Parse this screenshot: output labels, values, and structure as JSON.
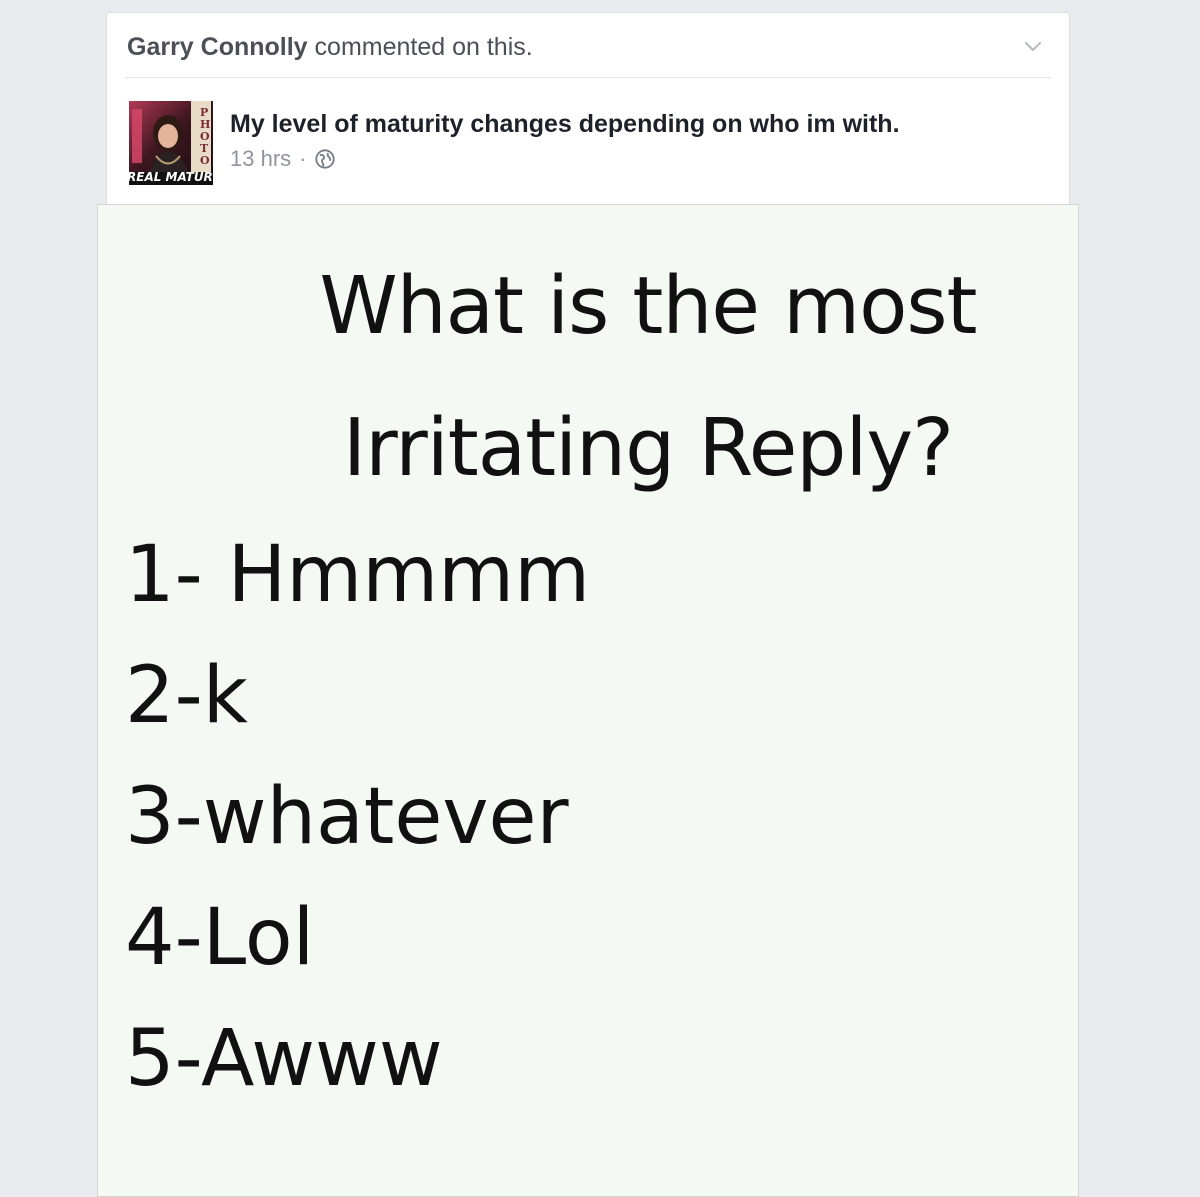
{
  "story": {
    "actor_name": "Garry Connolly",
    "action_text": "commented on this.",
    "menu_icon": "chevron-down-icon"
  },
  "post": {
    "page_title": "My level of maturity changes depending on who im with.",
    "avatar_text": "REAL MATURI",
    "avatar_side_text": "PHOTO",
    "time": "13 hrs",
    "separator": "·",
    "privacy_icon": "globe-icon"
  },
  "image": {
    "title_lines": [
      "What is the most",
      "Irritating Reply?"
    ],
    "options": [
      "1- Hmmmm",
      "2-k",
      "3-whatever",
      "4-Lol",
      "5-Awww"
    ]
  },
  "colors": {
    "background": "#e9ebee",
    "card": "#ffffff",
    "text_primary": "#1d2129",
    "text_secondary": "#90949c",
    "meme_background": "#f4f9f3"
  }
}
